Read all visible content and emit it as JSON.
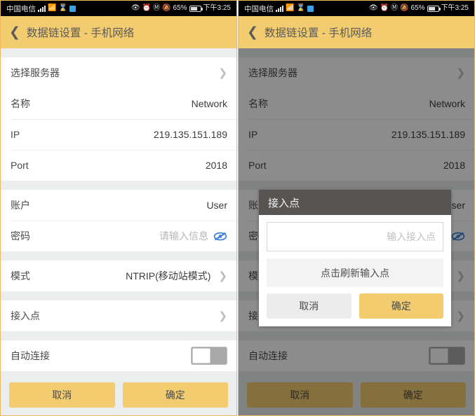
{
  "status_bar": {
    "carrier": "中国电信",
    "battery_percent": "65%",
    "time": "下午3:25",
    "icons": [
      "signal-icon",
      "wifi-icon",
      "hourglass-icon",
      "app-square-icon",
      "eye-icon",
      "alarm-clock-icon",
      "bluetooth-icon",
      "mute-icon",
      "battery-icon"
    ]
  },
  "app_bar": {
    "back_label": "‹",
    "title": "数据链设置 - 手机网络"
  },
  "list": {
    "group1": [
      {
        "label": "选择服务器",
        "value": "",
        "accessory": "chevron"
      }
    ],
    "group2": [
      {
        "label": "名称",
        "value": "Network",
        "accessory": "none"
      },
      {
        "label": "IP",
        "value": "219.135.151.189",
        "accessory": "none"
      },
      {
        "label": "Port",
        "value": "2018",
        "accessory": "none"
      }
    ],
    "group3": [
      {
        "label": "账户",
        "value": "User",
        "accessory": "none"
      },
      {
        "label": "密码",
        "value": "请输入信息",
        "accessory": "eye-slash",
        "is_placeholder": true
      }
    ],
    "group4": [
      {
        "label": "模式",
        "value": "NTRIP(移动站模式)",
        "accessory": "chevron"
      }
    ],
    "group5": [
      {
        "label": "接入点",
        "value": "",
        "accessory": "chevron"
      }
    ],
    "group6": [
      {
        "label": "自动连接",
        "value": "",
        "accessory": "switch",
        "switch_on": false
      }
    ]
  },
  "bottom_bar": {
    "cancel": "取消",
    "confirm": "确定"
  },
  "dialog": {
    "title": "接入点",
    "input_value": "",
    "input_placeholder": "输入接入点",
    "refresh_label": "点击刷新输入点",
    "cancel": "取消",
    "confirm": "确定"
  },
  "colors": {
    "accent_yellow": "#f2cc6f",
    "panel_border": "#f0b95e",
    "dialog_header": "#575553",
    "status_bar_bg": "#000000",
    "eye_icon_blue": "#3f82d8"
  }
}
